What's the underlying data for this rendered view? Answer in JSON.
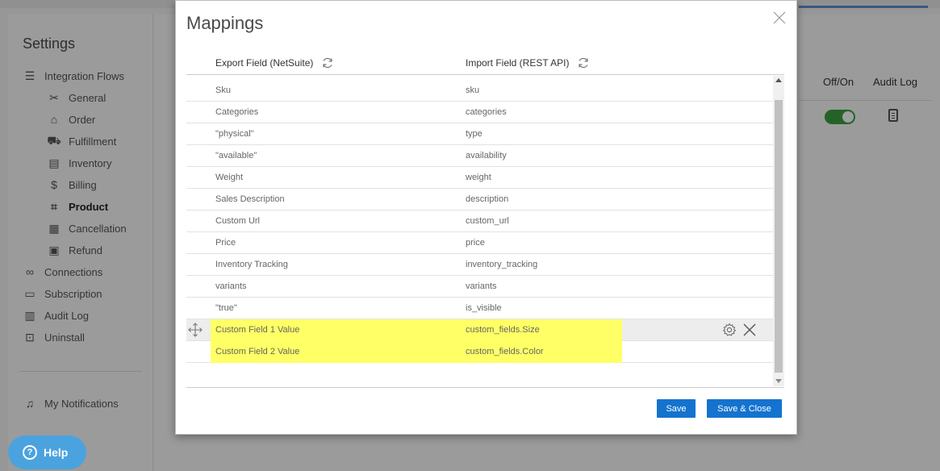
{
  "sidebar": {
    "title": "Settings",
    "items": [
      {
        "label": "Integration Flows",
        "icon": "list-icon"
      },
      {
        "label": "General",
        "icon": "tools-icon"
      },
      {
        "label": "Order",
        "icon": "store-icon"
      },
      {
        "label": "Fulfillment",
        "icon": "truck-icon"
      },
      {
        "label": "Inventory",
        "icon": "inventory-icon"
      },
      {
        "label": "Billing",
        "icon": "dollar-icon"
      },
      {
        "label": "Product",
        "icon": "tag-icon"
      },
      {
        "label": "Cancellation",
        "icon": "cancel-doc-icon"
      },
      {
        "label": "Refund",
        "icon": "refund-icon"
      },
      {
        "label": "Connections",
        "icon": "link-icon"
      },
      {
        "label": "Subscription",
        "icon": "id-card-icon"
      },
      {
        "label": "Audit Log",
        "icon": "log-icon"
      },
      {
        "label": "Uninstall",
        "icon": "uninstall-icon"
      }
    ],
    "notifications": "My Notifications",
    "help": "Help"
  },
  "main": {
    "col_offon": "Off/On",
    "col_audit": "Audit Log",
    "toggle_on": true
  },
  "modal": {
    "title": "Mappings",
    "export_header": "Export Field (NetSuite)",
    "import_header": "Import Field (REST API)",
    "rows": [
      {
        "export": "Sku",
        "import": "sku"
      },
      {
        "export": "Categories",
        "import": "categories"
      },
      {
        "export": "\"physical\"",
        "import": "type"
      },
      {
        "export": "\"available\"",
        "import": "availability"
      },
      {
        "export": "Weight",
        "import": "weight"
      },
      {
        "export": "Sales Description",
        "import": "description"
      },
      {
        "export": "Custom Url",
        "import": "custom_url"
      },
      {
        "export": "Price",
        "import": "price"
      },
      {
        "export": "Inventory Tracking",
        "import": "inventory_tracking"
      },
      {
        "export": "variants",
        "import": "variants"
      },
      {
        "export": "\"true\"",
        "import": "is_visible"
      },
      {
        "export": "Custom Field 1 Value",
        "import": "custom_fields.Size"
      },
      {
        "export": "Custom Field 2 Value",
        "import": "custom_fields.Color"
      },
      {
        "export": "",
        "import": ""
      }
    ],
    "save_label": "Save",
    "save_close_label": "Save & Close"
  },
  "colors": {
    "highlight": "#ffff66",
    "primary_button": "#1473cf",
    "toggle_on": "#3aa142",
    "help_button": "#4aa3df"
  }
}
